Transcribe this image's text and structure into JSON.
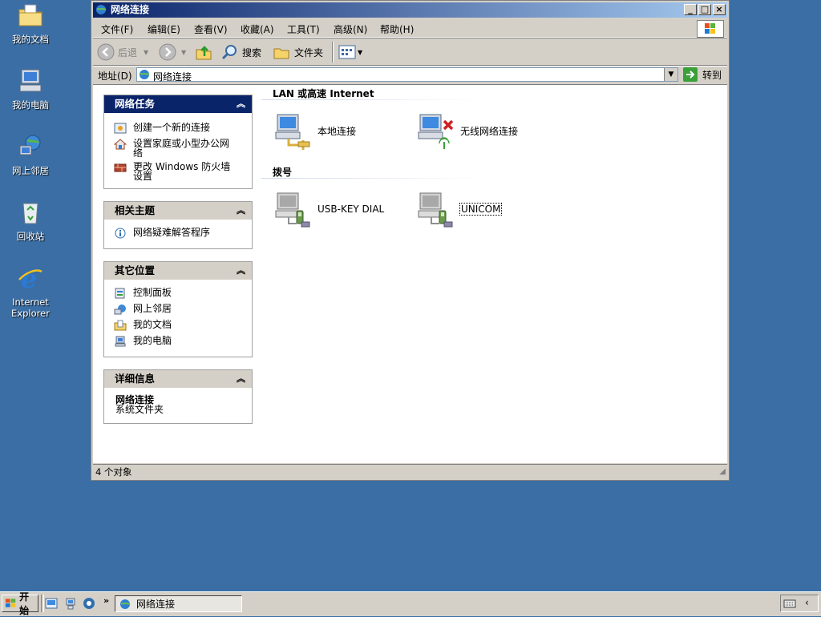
{
  "desktop": {
    "icons": [
      {
        "label": "我的文档",
        "icon": "my-documents-icon"
      },
      {
        "label": "我的电脑",
        "icon": "my-computer-icon"
      },
      {
        "label": "网上邻居",
        "icon": "network-places-icon"
      },
      {
        "label": "回收站",
        "icon": "recycle-bin-icon"
      },
      {
        "label": "Internet Explorer",
        "icon": "internet-explorer-icon"
      }
    ]
  },
  "window": {
    "title": "网络连接",
    "menu": [
      "文件(F)",
      "编辑(E)",
      "查看(V)",
      "收藏(A)",
      "工具(T)",
      "高级(N)",
      "帮助(H)"
    ],
    "toolbar": {
      "back": "后退",
      "search": "搜索",
      "folders": "文件夹"
    },
    "address": {
      "label": "地址(D)",
      "value": "网络连接",
      "go": "转到"
    },
    "status": "4 个对象"
  },
  "panels": {
    "tasks": {
      "title": "网络任务",
      "items": [
        "创建一个新的连接",
        "设置家庭或小型办公网络",
        "更改 Windows 防火墙设置"
      ]
    },
    "related": {
      "title": "相关主题",
      "items": [
        "网络疑难解答程序"
      ]
    },
    "other": {
      "title": "其它位置",
      "items": [
        "控制面板",
        "网上邻居",
        "我的文档",
        "我的电脑"
      ]
    },
    "details": {
      "title": "详细信息",
      "name": "网络连接",
      "type": "系统文件夹"
    }
  },
  "groups": [
    {
      "title": "LAN 或高速 Internet",
      "items": [
        "本地连接",
        "无线网络连接"
      ]
    },
    {
      "title": "拨号",
      "items": [
        "USB-KEY DIAL",
        "UNICOM"
      ]
    }
  ],
  "taskbar": {
    "start": "开始",
    "task": "网络连接"
  }
}
